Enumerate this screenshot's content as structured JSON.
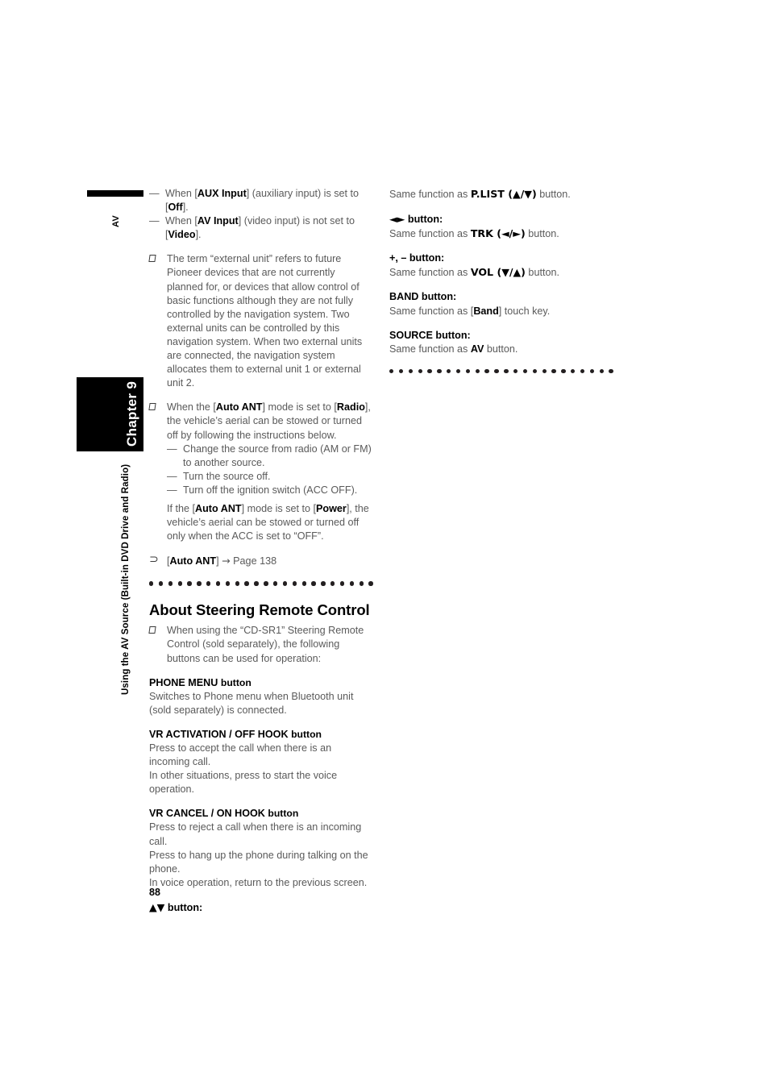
{
  "page": {
    "number": "88",
    "chapter_label": "Chapter 9",
    "running_head": "Using the AV Source (Built-in DVD Drive and Radio)",
    "av_tab": "AV"
  },
  "left_column": {
    "dash_items_top": [
      {
        "pre": "When [",
        "bold": "AUX Input",
        "mid": "] (auxiliary input) is set to [",
        "bold2": "Off",
        "post": "]."
      },
      {
        "pre": "When [",
        "bold": "AV Input",
        "mid": "] (video input) is not set to [",
        "bold2": "Video",
        "post": "]."
      }
    ],
    "note_external_unit": "The term “external unit” refers to future Pioneer devices that are not currently planned for, or devices that allow control of basic functions although they are not fully controlled by the navigation system. Two external units can be controlled by this navigation system. When two external units are connected, the navigation system allocates them to external unit 1 or external unit 2.",
    "note_auto_ant": {
      "lead_pre": "When the [",
      "lead_bold1": "Auto ANT",
      "lead_mid": "] mode is set to [",
      "lead_bold2": "Radio",
      "lead_post": "], the vehicle’s aerial can be stowed or turned off by following the instructions below.",
      "sub_items": [
        "Change the source from radio (AM or FM) to another source.",
        "Turn the source off.",
        "Turn off the ignition switch (ACC OFF)."
      ],
      "tail_pre": "If the [",
      "tail_bold1": "Auto ANT",
      "tail_mid": "] mode is set to [",
      "tail_bold2": "Power",
      "tail_post": "], the vehicle’s aerial can be stowed or turned off only when the ACC is set to “OFF”."
    },
    "reference": {
      "glyph": "⊃",
      "open": "[",
      "bold": "Auto ANT",
      "close": "]",
      "arrow": "→",
      "target": "Page 138"
    },
    "section_title": "About Steering Remote Control",
    "note_steering": "When using the “CD-SR1” Steering Remote Control (sold separately), the following buttons can be used for operation:",
    "buttons": [
      {
        "name": "PHONE MENU",
        "suffix": "button",
        "lines": [
          "Switches to Phone menu when Bluetooth unit (sold separately) is connected."
        ]
      },
      {
        "name": "VR ACTIVATION / OFF HOOK",
        "suffix": "button",
        "lines": [
          "Press to accept the call when there is an incoming call.",
          "In other situations, press to start the voice operation."
        ]
      },
      {
        "name": "VR CANCEL / ON HOOK",
        "suffix": "button",
        "lines": [
          "Press to reject a call when there is an incoming call.",
          "Press to hang up the phone during talking on the phone.",
          "In voice operation, return to the previous screen."
        ]
      }
    ],
    "last_button_head": {
      "symbols": "▲▼",
      "suffix": "button:"
    }
  },
  "right_column": {
    "first_line": {
      "pre": "Same function as ",
      "bold": "P.LIST (▲/▼)",
      "post": " button."
    },
    "entries": [
      {
        "head_symbols": "◄►",
        "head_suffix": "button:",
        "body_pre": "Same function as ",
        "body_bold": "TRK (◄/►)",
        "body_post": " button."
      },
      {
        "head_symbols": "+, –",
        "head_suffix": "button:",
        "body_pre": "Same function as ",
        "body_bold": "VOL (▼/▲)",
        "body_post": " button."
      },
      {
        "head_symbols": "BAND",
        "head_suffix": "button:",
        "body_pre": "Same function as [",
        "body_bold": "Band",
        "body_post": "] touch key."
      },
      {
        "head_symbols": "SOURCE",
        "head_suffix": "button:",
        "body_pre": "Same function as ",
        "body_bold": "AV",
        "body_post": " button."
      }
    ]
  }
}
